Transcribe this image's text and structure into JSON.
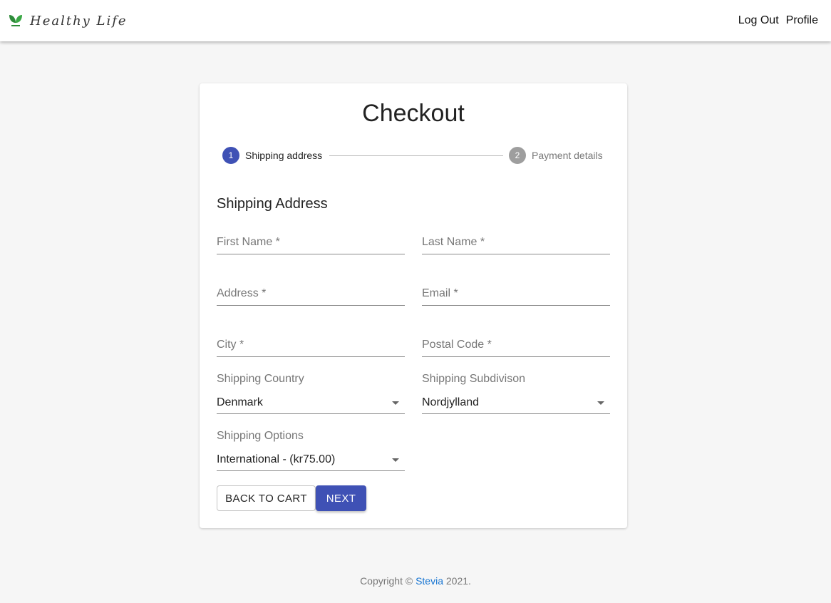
{
  "header": {
    "brand": "Healthy Life",
    "nav": {
      "logout": "Log Out",
      "profile": "Profile"
    }
  },
  "checkout": {
    "title": "Checkout",
    "steps": [
      {
        "number": "1",
        "label": "Shipping address",
        "active": true
      },
      {
        "number": "2",
        "label": "Payment details",
        "active": false
      }
    ],
    "section_title": "Shipping Address",
    "fields": {
      "first_name": {
        "label": "First Name *"
      },
      "last_name": {
        "label": "Last Name *"
      },
      "address": {
        "label": "Address *"
      },
      "email": {
        "label": "Email *"
      },
      "city": {
        "label": "City *"
      },
      "postal_code": {
        "label": "Postal Code *"
      },
      "shipping_country": {
        "label": "Shipping Country",
        "value": "Denmark"
      },
      "shipping_subdivision": {
        "label": "Shipping Subdivison",
        "value": "Nordjylland"
      },
      "shipping_options": {
        "label": "Shipping Options",
        "value": "International - (kr75.00)"
      }
    },
    "buttons": {
      "back": "BACK TO CART",
      "next": "NEXT"
    }
  },
  "footer": {
    "prefix": "Copyright ©",
    "link": "Stevia",
    "suffix": "2021."
  },
  "colors": {
    "primary": "#3f51b5",
    "inactive": "#9e9e9e",
    "link": "#1976d2"
  }
}
